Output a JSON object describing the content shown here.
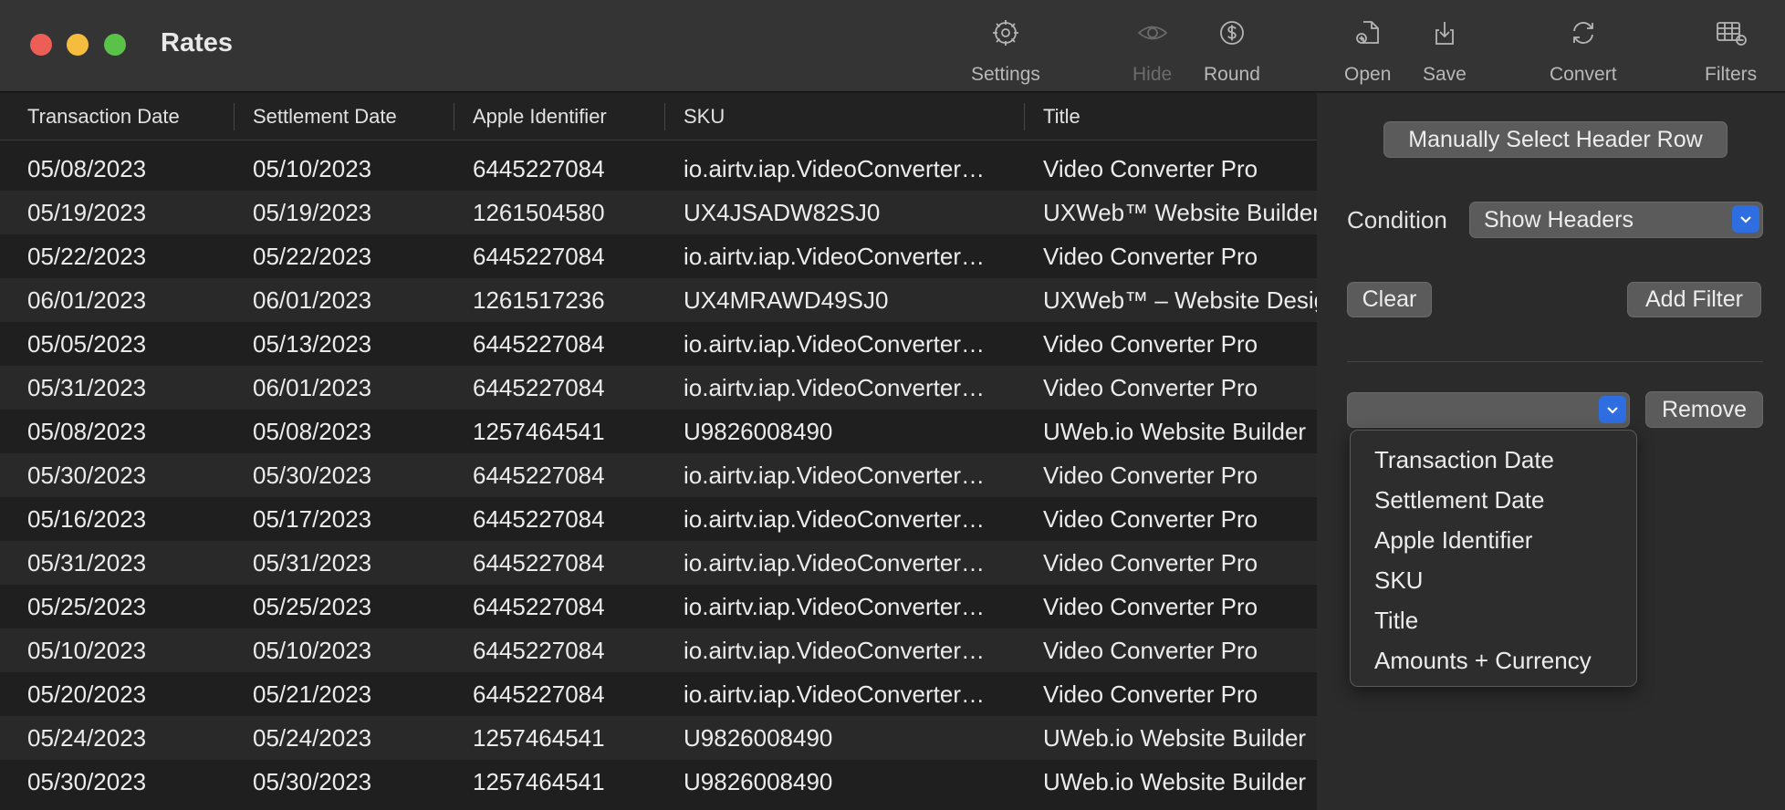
{
  "window": {
    "title": "Rates"
  },
  "toolbar": [
    {
      "label": "Settings",
      "icon": "gear-icon"
    },
    {
      "label": "Hide",
      "icon": "eye-icon"
    },
    {
      "label": "Round",
      "icon": "dollar-icon"
    },
    {
      "label": "Open",
      "icon": "document-add-icon"
    },
    {
      "label": "Save",
      "icon": "download-icon"
    },
    {
      "label": "Convert",
      "icon": "refresh-icon"
    },
    {
      "label": "Filters",
      "icon": "table-filter-icon"
    }
  ],
  "table": {
    "columns": [
      "Transaction Date",
      "Settlement Date",
      "Apple Identifier",
      "SKU",
      "Title"
    ],
    "rows": [
      [
        "05/08/2023",
        "05/10/2023",
        "6445227084",
        "io.airtv.iap.VideoConverter…",
        "Video Converter Pro"
      ],
      [
        "05/19/2023",
        "05/19/2023",
        "1261504580",
        "UX4JSADW82SJ0",
        "UXWeb™ Website Builder"
      ],
      [
        "05/22/2023",
        "05/22/2023",
        "6445227084",
        "io.airtv.iap.VideoConverter…",
        "Video Converter Pro"
      ],
      [
        "06/01/2023",
        "06/01/2023",
        "1261517236",
        "UX4MRAWD49SJ0",
        "UXWeb™ – Website Designer"
      ],
      [
        "05/05/2023",
        "05/13/2023",
        "6445227084",
        "io.airtv.iap.VideoConverter…",
        "Video Converter Pro"
      ],
      [
        "05/31/2023",
        "06/01/2023",
        "6445227084",
        "io.airtv.iap.VideoConverter…",
        "Video Converter Pro"
      ],
      [
        "05/08/2023",
        "05/08/2023",
        "1257464541",
        "U9826008490",
        "UWeb.io  Website Builder"
      ],
      [
        "05/30/2023",
        "05/30/2023",
        "6445227084",
        "io.airtv.iap.VideoConverter…",
        "Video Converter Pro"
      ],
      [
        "05/16/2023",
        "05/17/2023",
        "6445227084",
        "io.airtv.iap.VideoConverter…",
        "Video Converter Pro"
      ],
      [
        "05/31/2023",
        "05/31/2023",
        "6445227084",
        "io.airtv.iap.VideoConverter…",
        "Video Converter Pro"
      ],
      [
        "05/25/2023",
        "05/25/2023",
        "6445227084",
        "io.airtv.iap.VideoConverter…",
        "Video Converter Pro"
      ],
      [
        "05/10/2023",
        "05/10/2023",
        "6445227084",
        "io.airtv.iap.VideoConverter…",
        "Video Converter Pro"
      ],
      [
        "05/20/2023",
        "05/21/2023",
        "6445227084",
        "io.airtv.iap.VideoConverter…",
        "Video Converter Pro"
      ],
      [
        "05/24/2023",
        "05/24/2023",
        "1257464541",
        "U9826008490",
        "UWeb.io  Website Builder"
      ],
      [
        "05/30/2023",
        "05/30/2023",
        "1257464541",
        "U9826008490",
        "UWeb.io  Website Builder"
      ]
    ]
  },
  "panel": {
    "manual_header_label": "Manually Select Header Row",
    "condition_label": "Condition",
    "condition_value": "Show Headers",
    "clear_label": "Clear",
    "add_filter_label": "Add Filter",
    "column_select_value": "",
    "remove_label": "Remove",
    "column_options": [
      "Transaction Date",
      "Settlement Date",
      "Apple Identifier",
      "SKU",
      "Title",
      "Amounts + Currency"
    ]
  }
}
